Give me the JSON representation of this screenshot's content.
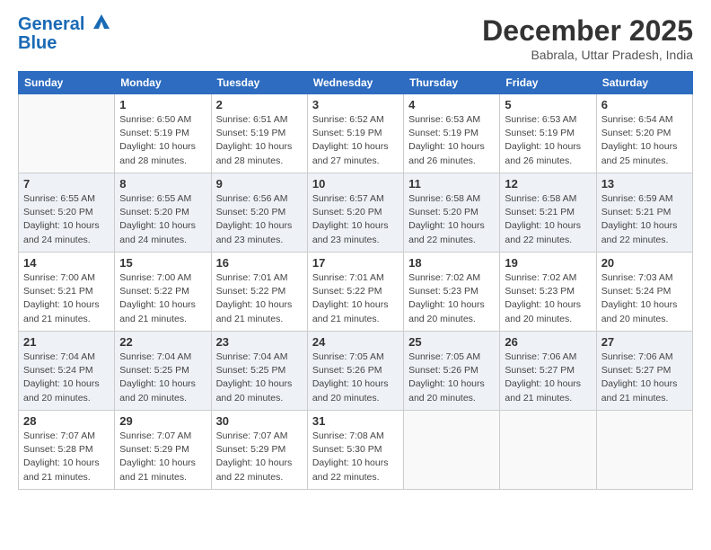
{
  "header": {
    "logo_line1": "General",
    "logo_line2": "Blue",
    "month": "December 2025",
    "location": "Babrala, Uttar Pradesh, India"
  },
  "weekdays": [
    "Sunday",
    "Monday",
    "Tuesday",
    "Wednesday",
    "Thursday",
    "Friday",
    "Saturday"
  ],
  "weeks": [
    [
      {
        "day": "",
        "info": ""
      },
      {
        "day": "1",
        "info": "Sunrise: 6:50 AM\nSunset: 5:19 PM\nDaylight: 10 hours\nand 28 minutes."
      },
      {
        "day": "2",
        "info": "Sunrise: 6:51 AM\nSunset: 5:19 PM\nDaylight: 10 hours\nand 28 minutes."
      },
      {
        "day": "3",
        "info": "Sunrise: 6:52 AM\nSunset: 5:19 PM\nDaylight: 10 hours\nand 27 minutes."
      },
      {
        "day": "4",
        "info": "Sunrise: 6:53 AM\nSunset: 5:19 PM\nDaylight: 10 hours\nand 26 minutes."
      },
      {
        "day": "5",
        "info": "Sunrise: 6:53 AM\nSunset: 5:19 PM\nDaylight: 10 hours\nand 26 minutes."
      },
      {
        "day": "6",
        "info": "Sunrise: 6:54 AM\nSunset: 5:20 PM\nDaylight: 10 hours\nand 25 minutes."
      }
    ],
    [
      {
        "day": "7",
        "info": "Sunrise: 6:55 AM\nSunset: 5:20 PM\nDaylight: 10 hours\nand 24 minutes."
      },
      {
        "day": "8",
        "info": "Sunrise: 6:55 AM\nSunset: 5:20 PM\nDaylight: 10 hours\nand 24 minutes."
      },
      {
        "day": "9",
        "info": "Sunrise: 6:56 AM\nSunset: 5:20 PM\nDaylight: 10 hours\nand 23 minutes."
      },
      {
        "day": "10",
        "info": "Sunrise: 6:57 AM\nSunset: 5:20 PM\nDaylight: 10 hours\nand 23 minutes."
      },
      {
        "day": "11",
        "info": "Sunrise: 6:58 AM\nSunset: 5:20 PM\nDaylight: 10 hours\nand 22 minutes."
      },
      {
        "day": "12",
        "info": "Sunrise: 6:58 AM\nSunset: 5:21 PM\nDaylight: 10 hours\nand 22 minutes."
      },
      {
        "day": "13",
        "info": "Sunrise: 6:59 AM\nSunset: 5:21 PM\nDaylight: 10 hours\nand 22 minutes."
      }
    ],
    [
      {
        "day": "14",
        "info": "Sunrise: 7:00 AM\nSunset: 5:21 PM\nDaylight: 10 hours\nand 21 minutes."
      },
      {
        "day": "15",
        "info": "Sunrise: 7:00 AM\nSunset: 5:22 PM\nDaylight: 10 hours\nand 21 minutes."
      },
      {
        "day": "16",
        "info": "Sunrise: 7:01 AM\nSunset: 5:22 PM\nDaylight: 10 hours\nand 21 minutes."
      },
      {
        "day": "17",
        "info": "Sunrise: 7:01 AM\nSunset: 5:22 PM\nDaylight: 10 hours\nand 21 minutes."
      },
      {
        "day": "18",
        "info": "Sunrise: 7:02 AM\nSunset: 5:23 PM\nDaylight: 10 hours\nand 20 minutes."
      },
      {
        "day": "19",
        "info": "Sunrise: 7:02 AM\nSunset: 5:23 PM\nDaylight: 10 hours\nand 20 minutes."
      },
      {
        "day": "20",
        "info": "Sunrise: 7:03 AM\nSunset: 5:24 PM\nDaylight: 10 hours\nand 20 minutes."
      }
    ],
    [
      {
        "day": "21",
        "info": "Sunrise: 7:04 AM\nSunset: 5:24 PM\nDaylight: 10 hours\nand 20 minutes."
      },
      {
        "day": "22",
        "info": "Sunrise: 7:04 AM\nSunset: 5:25 PM\nDaylight: 10 hours\nand 20 minutes."
      },
      {
        "day": "23",
        "info": "Sunrise: 7:04 AM\nSunset: 5:25 PM\nDaylight: 10 hours\nand 20 minutes."
      },
      {
        "day": "24",
        "info": "Sunrise: 7:05 AM\nSunset: 5:26 PM\nDaylight: 10 hours\nand 20 minutes."
      },
      {
        "day": "25",
        "info": "Sunrise: 7:05 AM\nSunset: 5:26 PM\nDaylight: 10 hours\nand 20 minutes."
      },
      {
        "day": "26",
        "info": "Sunrise: 7:06 AM\nSunset: 5:27 PM\nDaylight: 10 hours\nand 21 minutes."
      },
      {
        "day": "27",
        "info": "Sunrise: 7:06 AM\nSunset: 5:27 PM\nDaylight: 10 hours\nand 21 minutes."
      }
    ],
    [
      {
        "day": "28",
        "info": "Sunrise: 7:07 AM\nSunset: 5:28 PM\nDaylight: 10 hours\nand 21 minutes."
      },
      {
        "day": "29",
        "info": "Sunrise: 7:07 AM\nSunset: 5:29 PM\nDaylight: 10 hours\nand 21 minutes."
      },
      {
        "day": "30",
        "info": "Sunrise: 7:07 AM\nSunset: 5:29 PM\nDaylight: 10 hours\nand 22 minutes."
      },
      {
        "day": "31",
        "info": "Sunrise: 7:08 AM\nSunset: 5:30 PM\nDaylight: 10 hours\nand 22 minutes."
      },
      {
        "day": "",
        "info": ""
      },
      {
        "day": "",
        "info": ""
      },
      {
        "day": "",
        "info": ""
      }
    ]
  ]
}
